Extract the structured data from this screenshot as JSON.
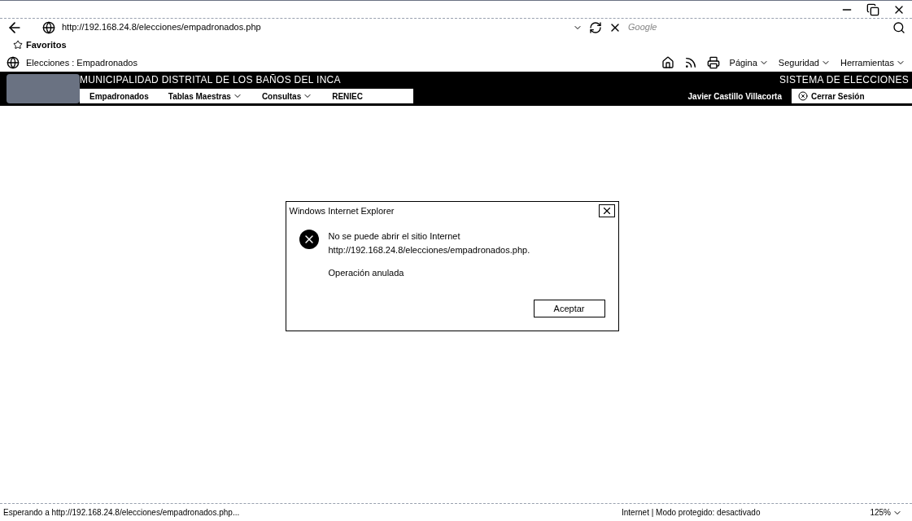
{
  "address_bar": {
    "url": "http://192.168.24.8/elecciones/empadronados.php",
    "search_placeholder": "Google"
  },
  "favorites_bar": {
    "label": "Favoritos"
  },
  "tab": {
    "title": "Elecciones : Empadronados"
  },
  "command_bar": [
    "Página",
    "Seguridad",
    "Herramientas"
  ],
  "site_header": {
    "title": "MUNICIPALIDAD DISTRITAL DE LOS BAÑOS DEL INCA",
    "system": "SISTEMA DE ELECCIONES",
    "user": "Javier Castillo Villacorta",
    "logout": "Cerrar Sesión"
  },
  "nav": [
    {
      "label": "Empadronados",
      "dropdown": false
    },
    {
      "label": "Tablas Maestras",
      "dropdown": true
    },
    {
      "label": "Consultas",
      "dropdown": true
    },
    {
      "label": "RENIEC",
      "dropdown": false
    }
  ],
  "dialog": {
    "title": "Windows Internet Explorer",
    "message_line_1": "No se puede abrir el sitio Internet",
    "message_line_2": "http://192.168.24.8/elecciones/empadronados.php.",
    "detail": "Operación anulada",
    "button": "Aceptar"
  },
  "status_bar": {
    "text": "Esperando a http://192.168.24.8/elecciones/empadronados.php...",
    "zone": "Internet | Modo protegido: desactivado",
    "zoom": "125%"
  }
}
